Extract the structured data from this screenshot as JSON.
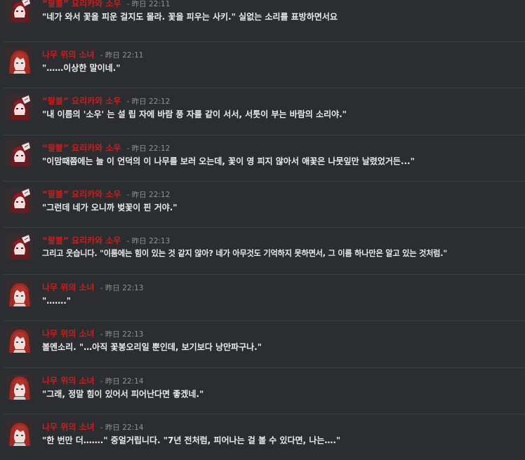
{
  "colors": {
    "background": "#2b2d31",
    "author_name": "#c81f1f",
    "timestamp": "#8e9297",
    "message_text": "#ebebeb",
    "divider": "#3c3e44"
  },
  "messages": [
    {
      "avatar_icon": "soun-avatar-icon",
      "author": "“팔불” 요리카와 소우",
      "sep": "-",
      "day": "昨日",
      "time": "22:11",
      "text": "\"네가 와서 꽃을 피운 걸지도 몰라. 꽃을 피우는 사키.\" 실없는 소리를 표방하면서요"
    },
    {
      "avatar_icon": "girl-avatar-icon",
      "author": "나무 위의 소녀",
      "sep": "-",
      "day": "昨日",
      "time": "22:11",
      "text": "\"……이상한 말이네.\""
    },
    {
      "avatar_icon": "soun-avatar-icon",
      "author": "“팔불” 요리카와 소우",
      "sep": "-",
      "day": "昨日",
      "time": "22:12",
      "text": "\"내 이름의 '소우' 는 설 립 자에 바람 풍 자를 같이 서서, 서툿이 부는 바람의 소리야.\""
    },
    {
      "avatar_icon": "soun-avatar-icon",
      "author": "“팔불” 요리카와 소우",
      "sep": "-",
      "day": "昨日",
      "time": "22:12",
      "text": "\"이맘때쯤에는 늘 이 언덕의 이 나무를 보러 오는데, 꽃이 영 피지 않아서 애꽃은 나뭇잎만 날렸었거든...\""
    },
    {
      "avatar_icon": "soun-avatar-icon",
      "author": "“팔불” 요리카와 소우",
      "sep": "-",
      "day": "昨日",
      "time": "22:12",
      "text": "\"그런데 네가 오니까 벚꽃이 핀 거야.\""
    },
    {
      "avatar_icon": "soun-avatar-icon",
      "author": "“팔불” 요리카와 소우",
      "sep": "-",
      "day": "昨日",
      "time": "22:13",
      "text": "그리고 웃습니다. \"이름에는 힘이 있는 것 같지 않아? 네가 아무것도 기억하지 못하면서, 그 이름 하나만은 알고 있는 것처럼.\""
    },
    {
      "avatar_icon": "girl-avatar-icon",
      "author": "나무 위의 소녀",
      "sep": "-",
      "day": "昨日",
      "time": "22:13",
      "text": "\"…….\""
    },
    {
      "avatar_icon": "girl-avatar-icon",
      "author": "나무 위의 소녀",
      "sep": "-",
      "day": "昨日",
      "time": "22:13",
      "text": "볼멘소리. \"…아직 꽃봉오리일 뿐인데, 보기보다 낭만파구나.\""
    },
    {
      "avatar_icon": "girl-avatar-icon",
      "author": "나무 위의 소녀",
      "sep": "-",
      "day": "昨日",
      "time": "22:14",
      "text": "\"그래, 정말 힘이 있어서 피어난다면 좋겠네.\""
    },
    {
      "avatar_icon": "girl-avatar-icon",
      "author": "나무 위의 소녀",
      "sep": "-",
      "day": "昨日",
      "time": "22:14",
      "text": "\"한 번만 더…….\" 중얼거립니다. \"7년 전처럼, 피어나는 걸 볼 수 있다면, 나는….\""
    }
  ]
}
